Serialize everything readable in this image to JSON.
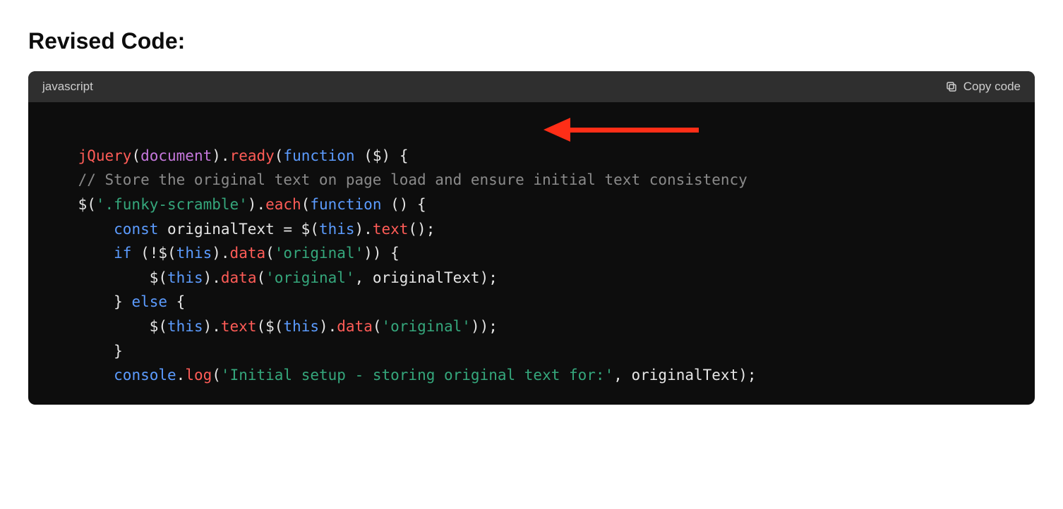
{
  "heading": "Revised Code:",
  "code_block": {
    "language": "javascript",
    "copy_label": "Copy code"
  },
  "code": {
    "l1": {
      "a": "jQuery",
      "b": "(",
      "c": "document",
      "d": ").",
      "e": "ready",
      "f": "(",
      "g": "function",
      "h": " (",
      "i": "$",
      "j": ") {"
    },
    "l2": "    // Store the original text on page load and ensure initial text consistency",
    "l3": {
      "a": "    $(",
      "b": "'.funky-scramble'",
      "c": ").",
      "d": "each",
      "e": "(",
      "f": "function",
      "g": " () {"
    },
    "l4": {
      "a": "        ",
      "b": "const",
      "c": " originalText = $(",
      "d": "this",
      "e": ").",
      "f": "text",
      "g": "();"
    },
    "l5": {
      "a": "        ",
      "b": "if",
      "c": " (!$(",
      "d": "this",
      "e": ").",
      "f": "data",
      "g": "(",
      "h": "'original'",
      "i": ")) {"
    },
    "l6": {
      "a": "            $(",
      "b": "this",
      "c": ").",
      "d": "data",
      "e": "(",
      "f": "'original'",
      "g": ", originalText);"
    },
    "l7": {
      "a": "        } ",
      "b": "else",
      "c": " {"
    },
    "l8": {
      "a": "            $(",
      "b": "this",
      "c": ").",
      "d": "text",
      "e": "($(",
      "f": "this",
      "g": ").",
      "h": "data",
      "i": "(",
      "j": "'original'",
      "k": "));"
    },
    "l9": "        }",
    "l10": {
      "a": "        ",
      "b": "console",
      "c": ".",
      "d": "log",
      "e": "(",
      "f": "'Initial setup - storing original text for:'",
      "g": ", originalText);"
    }
  }
}
